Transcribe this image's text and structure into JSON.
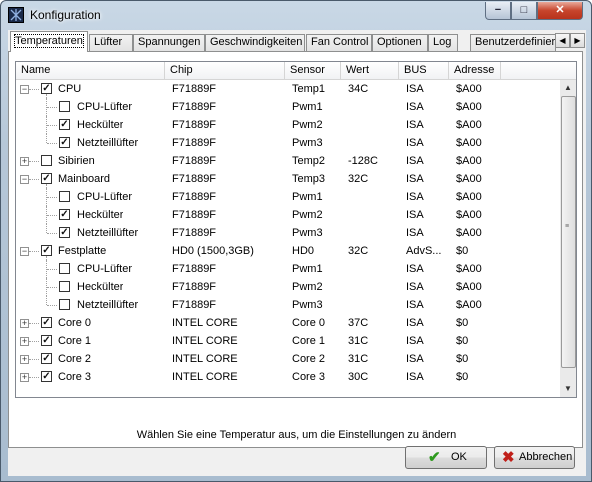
{
  "window": {
    "title": "Konfiguration",
    "min_glyph": "−",
    "max_glyph": "□",
    "close_glyph": "✕"
  },
  "tabs": [
    {
      "label": "Temperaturen",
      "active": true
    },
    {
      "label": "Lüfter"
    },
    {
      "label": "Spannungen"
    },
    {
      "label": "Geschwindigkeiten"
    },
    {
      "label": "Fan Control"
    },
    {
      "label": "Optionen"
    },
    {
      "label": "Log"
    },
    {
      "label": "Benutzerdefinier"
    }
  ],
  "tab_scroll": {
    "left": "◀",
    "right": "▶"
  },
  "columns": [
    "Name",
    "Chip",
    "Sensor",
    "Wert",
    "BUS",
    "Adresse"
  ],
  "rows": [
    {
      "level": 0,
      "expander": "−",
      "checked": true,
      "name": "CPU",
      "chip": "F71889F",
      "sensor": "Temp1",
      "wert": "34C",
      "bus": "ISA",
      "adresse": "$A00"
    },
    {
      "level": 1,
      "checked": false,
      "name": "CPU-Lüfter",
      "chip": "F71889F",
      "sensor": "Pwm1",
      "wert": "",
      "bus": "ISA",
      "adresse": "$A00"
    },
    {
      "level": 1,
      "checked": true,
      "name": "Heckülter",
      "chip": "F71889F",
      "sensor": "Pwm2",
      "wert": "",
      "bus": "ISA",
      "adresse": "$A00"
    },
    {
      "level": 1,
      "checked": true,
      "name": "Netzteillüfter",
      "chip": "F71889F",
      "sensor": "Pwm3",
      "wert": "",
      "bus": "ISA",
      "adresse": "$A00"
    },
    {
      "level": 0,
      "expander": "+",
      "checked": false,
      "name": "Sibirien",
      "chip": "F71889F",
      "sensor": "Temp2",
      "wert": "-128C",
      "bus": "ISA",
      "adresse": "$A00"
    },
    {
      "level": 0,
      "expander": "−",
      "checked": true,
      "name": "Mainboard",
      "chip": "F71889F",
      "sensor": "Temp3",
      "wert": "32C",
      "bus": "ISA",
      "adresse": "$A00"
    },
    {
      "level": 1,
      "checked": false,
      "name": "CPU-Lüfter",
      "chip": "F71889F",
      "sensor": "Pwm1",
      "wert": "",
      "bus": "ISA",
      "adresse": "$A00"
    },
    {
      "level": 1,
      "checked": true,
      "name": "Heckülter",
      "chip": "F71889F",
      "sensor": "Pwm2",
      "wert": "",
      "bus": "ISA",
      "adresse": "$A00"
    },
    {
      "level": 1,
      "checked": true,
      "name": "Netzteillüfter",
      "chip": "F71889F",
      "sensor": "Pwm3",
      "wert": "",
      "bus": "ISA",
      "adresse": "$A00"
    },
    {
      "level": 0,
      "expander": "−",
      "checked": true,
      "name": "Festplatte",
      "chip": "HD0 (1500,3GB)",
      "sensor": "HD0",
      "wert": "32C",
      "bus": "AdvS...",
      "adresse": "$0"
    },
    {
      "level": 1,
      "checked": false,
      "name": "CPU-Lüfter",
      "chip": "F71889F",
      "sensor": "Pwm1",
      "wert": "",
      "bus": "ISA",
      "adresse": "$A00"
    },
    {
      "level": 1,
      "checked": false,
      "name": "Heckülter",
      "chip": "F71889F",
      "sensor": "Pwm2",
      "wert": "",
      "bus": "ISA",
      "adresse": "$A00"
    },
    {
      "level": 1,
      "checked": false,
      "name": "Netzteillüfter",
      "chip": "F71889F",
      "sensor": "Pwm3",
      "wert": "",
      "bus": "ISA",
      "adresse": "$A00"
    },
    {
      "level": 0,
      "expander": "+",
      "checked": true,
      "name": "Core 0",
      "chip": "INTEL CORE",
      "sensor": "Core 0",
      "wert": "37C",
      "bus": "ISA",
      "adresse": "$0"
    },
    {
      "level": 0,
      "expander": "+",
      "checked": true,
      "name": "Core 1",
      "chip": "INTEL CORE",
      "sensor": "Core 1",
      "wert": "31C",
      "bus": "ISA",
      "adresse": "$0"
    },
    {
      "level": 0,
      "expander": "+",
      "checked": true,
      "name": "Core 2",
      "chip": "INTEL CORE",
      "sensor": "Core 2",
      "wert": "31C",
      "bus": "ISA",
      "adresse": "$0"
    },
    {
      "level": 0,
      "expander": "+",
      "checked": true,
      "name": "Core 3",
      "chip": "INTEL CORE",
      "sensor": "Core 3",
      "wert": "30C",
      "bus": "ISA",
      "adresse": "$0"
    }
  ],
  "check_glyph": "✓",
  "scrollbar": {
    "up": "▲",
    "down": "▼",
    "grip": "≡"
  },
  "status_text": "Wählen Sie eine Temperatur aus, um die Einstellungen zu ändern",
  "buttons": {
    "ok": {
      "label": "OK",
      "icon": "✔",
      "icon_color": "#2e9a1e"
    },
    "cancel": {
      "label": "Abbrechen",
      "icon": "✖",
      "icon_color": "#c0201a"
    }
  }
}
